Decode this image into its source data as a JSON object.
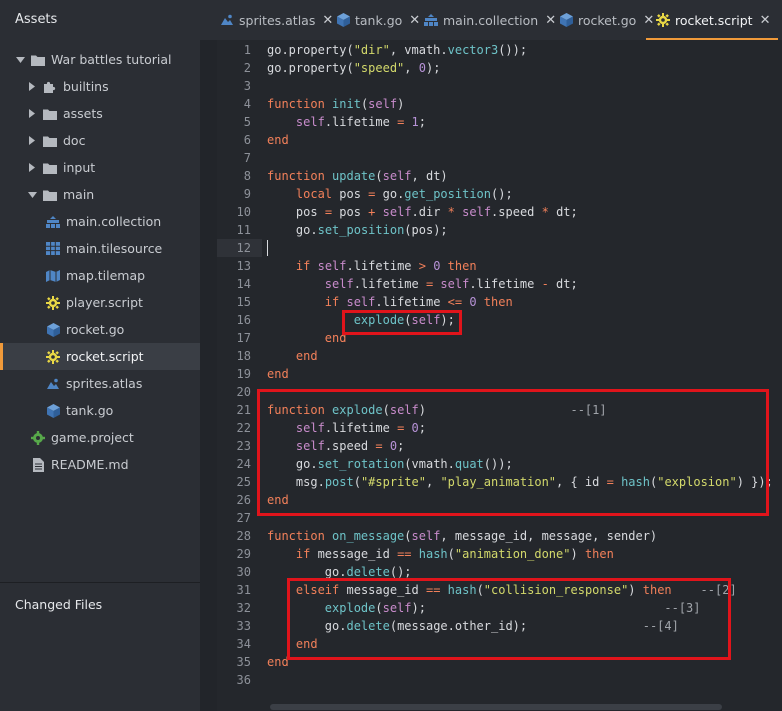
{
  "sidebar": {
    "title": "Assets",
    "tree": [
      {
        "label": "War battles tutorial",
        "depth": 0,
        "arrow": "down",
        "icon": "folder"
      },
      {
        "label": "builtins",
        "depth": 1,
        "arrow": "right",
        "icon": "puzzle"
      },
      {
        "label": "assets",
        "depth": 1,
        "arrow": "right",
        "icon": "folder"
      },
      {
        "label": "doc",
        "depth": 1,
        "arrow": "right",
        "icon": "folder"
      },
      {
        "label": "input",
        "depth": 1,
        "arrow": "right",
        "icon": "folder"
      },
      {
        "label": "main",
        "depth": 1,
        "arrow": "down",
        "icon": "folder"
      },
      {
        "label": "main.collection",
        "depth": 2,
        "arrow": "none",
        "icon": "collection"
      },
      {
        "label": "main.tilesource",
        "depth": 2,
        "arrow": "none",
        "icon": "tilesource"
      },
      {
        "label": "map.tilemap",
        "depth": 2,
        "arrow": "none",
        "icon": "tilemap"
      },
      {
        "label": "player.script",
        "depth": 2,
        "arrow": "none",
        "icon": "gear"
      },
      {
        "label": "rocket.go",
        "depth": 2,
        "arrow": "none",
        "icon": "cube"
      },
      {
        "label": "rocket.script",
        "depth": 2,
        "arrow": "none",
        "icon": "gear",
        "selected": true
      },
      {
        "label": "sprites.atlas",
        "depth": 2,
        "arrow": "none",
        "icon": "atlas"
      },
      {
        "label": "tank.go",
        "depth": 2,
        "arrow": "none",
        "icon": "cube"
      },
      {
        "label": "game.project",
        "depth": 1,
        "arrow": "none",
        "icon": "project"
      },
      {
        "label": "README.md",
        "depth": 1,
        "arrow": "none",
        "icon": "document"
      }
    ],
    "changed_files_title": "Changed Files"
  },
  "tabs": [
    {
      "label": "sprites.atlas",
      "icon": "atlas",
      "close": "✕"
    },
    {
      "label": "tank.go",
      "icon": "cube",
      "close": "✕"
    },
    {
      "label": "main.collection",
      "icon": "collection",
      "close": "✕"
    },
    {
      "label": "rocket.go",
      "icon": "cube",
      "close": "✕"
    },
    {
      "label": "rocket.script",
      "icon": "gear",
      "close": "✕",
      "active": true
    }
  ],
  "editor": {
    "current_line": 12,
    "lines": [
      {
        "n": "1",
        "tokens": [
          [
            "",
            "go.property("
          ],
          [
            "s",
            "\"dir\""
          ],
          [
            "",
            ", vmath."
          ],
          [
            "f",
            "vector3"
          ],
          [
            "",
            "());"
          ]
        ]
      },
      {
        "n": "2",
        "tokens": [
          [
            "",
            "go.property("
          ],
          [
            "s",
            "\"speed\""
          ],
          [
            "",
            ", "
          ],
          [
            "n",
            "0"
          ],
          [
            "",
            ");"
          ]
        ]
      },
      {
        "n": "3",
        "tokens": []
      },
      {
        "n": "4",
        "tokens": [
          [
            "k",
            "function "
          ],
          [
            "f",
            "init"
          ],
          [
            "",
            "("
          ],
          [
            "sl",
            "self"
          ],
          [
            "",
            ")"
          ]
        ]
      },
      {
        "n": "5",
        "tokens": [
          [
            "ig",
            "    "
          ],
          [
            "sl",
            "self"
          ],
          [
            "",
            ".lifetime "
          ],
          [
            "o",
            "="
          ],
          [
            "n",
            " 1"
          ],
          [
            "",
            ";"
          ]
        ]
      },
      {
        "n": "6",
        "tokens": [
          [
            "k",
            "end"
          ]
        ]
      },
      {
        "n": "7",
        "tokens": []
      },
      {
        "n": "8",
        "tokens": [
          [
            "k",
            "function "
          ],
          [
            "f",
            "update"
          ],
          [
            "",
            "("
          ],
          [
            "sl",
            "self"
          ],
          [
            "",
            ", dt)"
          ]
        ]
      },
      {
        "n": "9",
        "tokens": [
          [
            "ig",
            "    "
          ],
          [
            "k",
            "local"
          ],
          [
            "",
            " pos "
          ],
          [
            "o",
            "="
          ],
          [
            "",
            " go."
          ],
          [
            "f",
            "get_position"
          ],
          [
            "",
            "();"
          ]
        ]
      },
      {
        "n": "10",
        "tokens": [
          [
            "ig",
            "    "
          ],
          [
            "",
            "pos "
          ],
          [
            "o",
            "="
          ],
          [
            "",
            " pos "
          ],
          [
            "o",
            "+"
          ],
          [
            "",
            " "
          ],
          [
            "sl",
            "self"
          ],
          [
            "",
            ".dir "
          ],
          [
            "o",
            "*"
          ],
          [
            "",
            " "
          ],
          [
            "sl",
            "self"
          ],
          [
            "",
            ".speed "
          ],
          [
            "o",
            "*"
          ],
          [
            "",
            " dt;"
          ]
        ]
      },
      {
        "n": "11",
        "tokens": [
          [
            "ig",
            "    "
          ],
          [
            "",
            "go."
          ],
          [
            "f",
            "set_position"
          ],
          [
            "",
            "(pos);"
          ]
        ]
      },
      {
        "n": "12",
        "tokens": []
      },
      {
        "n": "13",
        "tokens": [
          [
            "ig",
            "    "
          ],
          [
            "k",
            "if"
          ],
          [
            "",
            " "
          ],
          [
            "sl",
            "self"
          ],
          [
            "",
            ".lifetime "
          ],
          [
            "o",
            ">"
          ],
          [
            "n",
            " 0"
          ],
          [
            "",
            " "
          ],
          [
            "k",
            "then"
          ]
        ]
      },
      {
        "n": "14",
        "tokens": [
          [
            "ig",
            "        "
          ],
          [
            "sl",
            "self"
          ],
          [
            "",
            ".lifetime "
          ],
          [
            "o",
            "="
          ],
          [
            "",
            " "
          ],
          [
            "sl",
            "self"
          ],
          [
            "",
            ".lifetime "
          ],
          [
            "o",
            "-"
          ],
          [
            "",
            " dt;"
          ]
        ]
      },
      {
        "n": "15",
        "tokens": [
          [
            "ig",
            "        "
          ],
          [
            "k",
            "if"
          ],
          [
            "",
            " "
          ],
          [
            "sl",
            "self"
          ],
          [
            "",
            ".lifetime "
          ],
          [
            "o",
            "<="
          ],
          [
            "n",
            " 0"
          ],
          [
            "",
            " "
          ],
          [
            "k",
            "then"
          ]
        ]
      },
      {
        "n": "16",
        "tokens": [
          [
            "ig",
            "            "
          ],
          [
            "f",
            "explode"
          ],
          [
            "",
            "("
          ],
          [
            "sl",
            "self"
          ],
          [
            "",
            ");"
          ]
        ]
      },
      {
        "n": "17",
        "tokens": [
          [
            "ig",
            "        "
          ],
          [
            "k",
            "end"
          ]
        ]
      },
      {
        "n": "18",
        "tokens": [
          [
            "ig",
            "    "
          ],
          [
            "k",
            "end"
          ]
        ]
      },
      {
        "n": "19",
        "tokens": [
          [
            "k",
            "end"
          ]
        ]
      },
      {
        "n": "20",
        "tokens": []
      },
      {
        "n": "21",
        "tokens": [
          [
            "k",
            "function "
          ],
          [
            "f",
            "explode"
          ],
          [
            "",
            "("
          ],
          [
            "sl",
            "self"
          ],
          [
            "",
            ")"
          ],
          [
            "c",
            "                    --[1]"
          ]
        ]
      },
      {
        "n": "22",
        "tokens": [
          [
            "ig",
            "    "
          ],
          [
            "sl",
            "self"
          ],
          [
            "",
            ".lifetime "
          ],
          [
            "o",
            "="
          ],
          [
            "n",
            " 0"
          ],
          [
            "",
            ";"
          ]
        ]
      },
      {
        "n": "23",
        "tokens": [
          [
            "ig",
            "    "
          ],
          [
            "sl",
            "self"
          ],
          [
            "",
            ".speed "
          ],
          [
            "o",
            "="
          ],
          [
            "n",
            " 0"
          ],
          [
            "",
            ";"
          ]
        ]
      },
      {
        "n": "24",
        "tokens": [
          [
            "ig",
            "    "
          ],
          [
            "",
            "go."
          ],
          [
            "f",
            "set_rotation"
          ],
          [
            "",
            "(vmath."
          ],
          [
            "f",
            "quat"
          ],
          [
            "",
            "());"
          ]
        ]
      },
      {
        "n": "25",
        "tokens": [
          [
            "ig",
            "    "
          ],
          [
            "",
            "msg."
          ],
          [
            "f",
            "post"
          ],
          [
            "",
            "("
          ],
          [
            "s",
            "\"#sprite\""
          ],
          [
            "",
            ", "
          ],
          [
            "s",
            "\"play_animation\""
          ],
          [
            "",
            ", { id "
          ],
          [
            "o",
            "="
          ],
          [
            "",
            " "
          ],
          [
            "f",
            "hash"
          ],
          [
            "",
            "("
          ],
          [
            "s",
            "\"explosion\""
          ],
          [
            "",
            ") });"
          ]
        ]
      },
      {
        "n": "26",
        "tokens": [
          [
            "k",
            "end"
          ]
        ]
      },
      {
        "n": "27",
        "tokens": []
      },
      {
        "n": "28",
        "tokens": [
          [
            "k",
            "function "
          ],
          [
            "f",
            "on_message"
          ],
          [
            "",
            "("
          ],
          [
            "sl",
            "self"
          ],
          [
            "",
            ", message_id, message, sender)"
          ]
        ]
      },
      {
        "n": "29",
        "tokens": [
          [
            "ig",
            "    "
          ],
          [
            "k",
            "if"
          ],
          [
            "",
            " message_id "
          ],
          [
            "o",
            "=="
          ],
          [
            "",
            " "
          ],
          [
            "f",
            "hash"
          ],
          [
            "",
            "("
          ],
          [
            "s",
            "\"animation_done\""
          ],
          [
            "",
            ") "
          ],
          [
            "k",
            "then"
          ]
        ]
      },
      {
        "n": "30",
        "tokens": [
          [
            "ig",
            "        "
          ],
          [
            "",
            "go."
          ],
          [
            "f",
            "delete"
          ],
          [
            "",
            "();"
          ]
        ]
      },
      {
        "n": "31",
        "tokens": [
          [
            "ig",
            "    "
          ],
          [
            "k",
            "elseif"
          ],
          [
            "",
            " message_id "
          ],
          [
            "o",
            "=="
          ],
          [
            "",
            " "
          ],
          [
            "f",
            "hash"
          ],
          [
            "",
            "("
          ],
          [
            "s",
            "\"collision_response\""
          ],
          [
            "",
            ") "
          ],
          [
            "k",
            "then"
          ],
          [
            "c",
            "    --[2]"
          ]
        ]
      },
      {
        "n": "32",
        "tokens": [
          [
            "ig",
            "        "
          ],
          [
            "f",
            "explode"
          ],
          [
            "",
            "("
          ],
          [
            "sl",
            "self"
          ],
          [
            "",
            ");"
          ],
          [
            "c",
            "                                 --[3]"
          ]
        ]
      },
      {
        "n": "33",
        "tokens": [
          [
            "ig",
            "        "
          ],
          [
            "",
            "go."
          ],
          [
            "f",
            "delete"
          ],
          [
            "",
            "(message.other_id);"
          ],
          [
            "c",
            "                --[4]"
          ]
        ]
      },
      {
        "n": "34",
        "tokens": [
          [
            "ig",
            "    "
          ],
          [
            "k",
            "end"
          ]
        ]
      },
      {
        "n": "35",
        "tokens": [
          [
            "k",
            "end"
          ]
        ]
      },
      {
        "n": "36",
        "tokens": []
      }
    ]
  },
  "colors": {
    "accent": "#f09a3a",
    "highlight_box": "#e0141b",
    "keyword": "#f2805a",
    "function": "#6ec3c8",
    "string": "#d3d96b",
    "number": "#b893d8",
    "self": "#c98ccc"
  }
}
